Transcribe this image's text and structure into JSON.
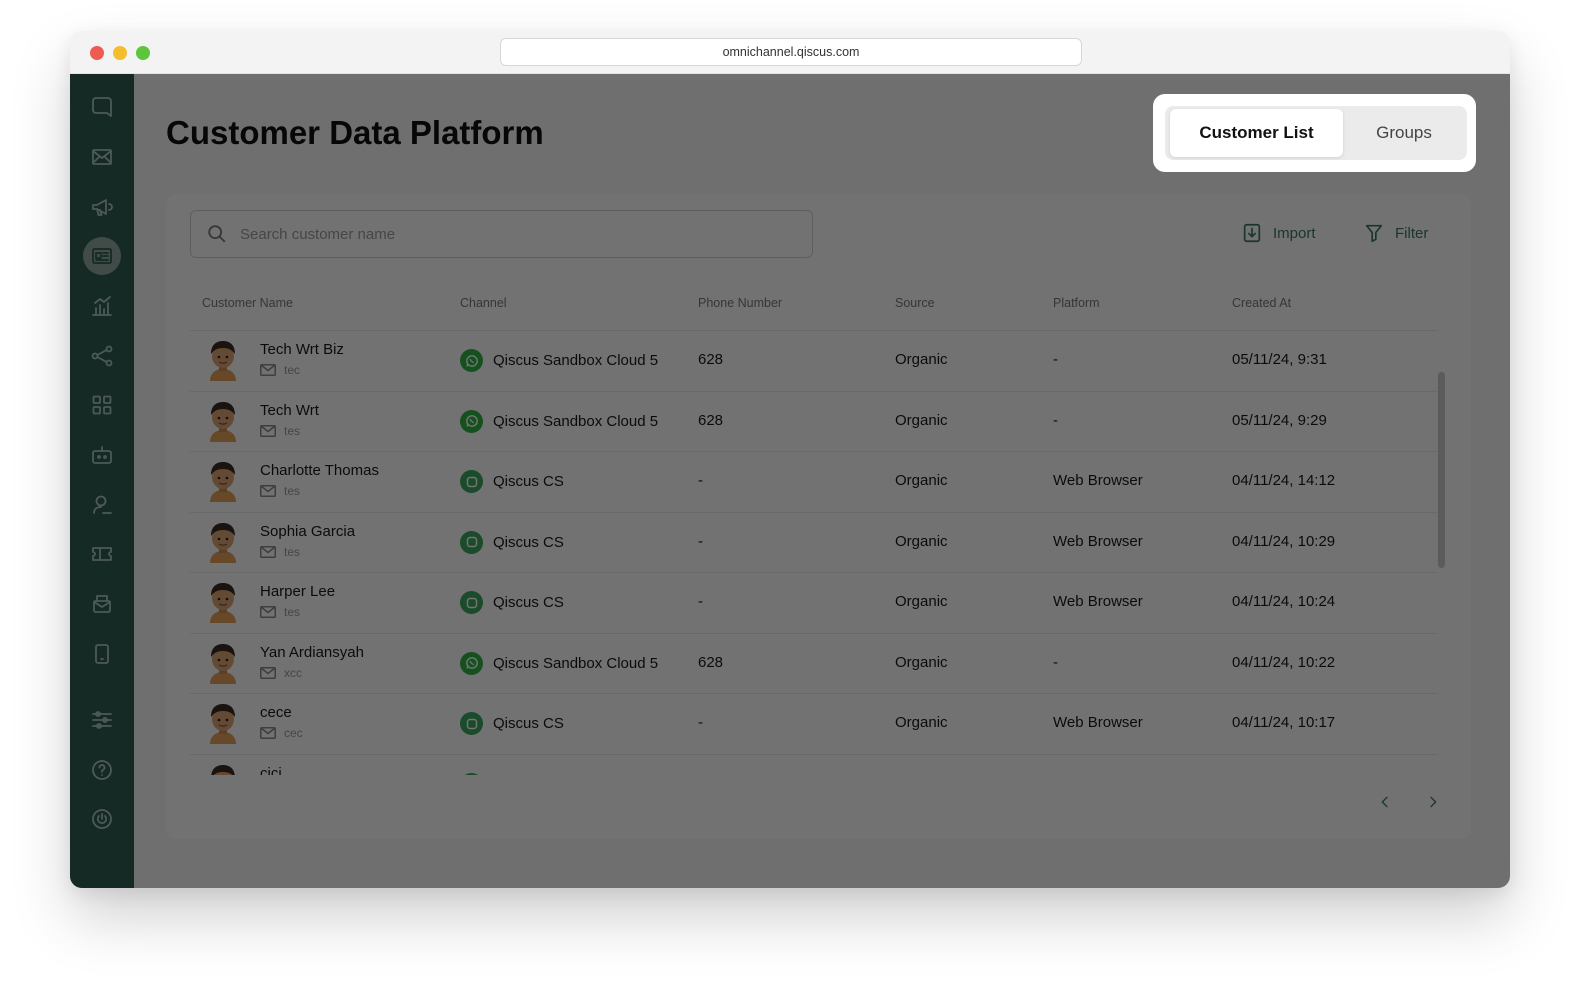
{
  "browser": {
    "url": "omnichannel.qiscus.com"
  },
  "sidebar": {
    "items": [
      {
        "icon": "qiscus-logo-icon",
        "active": false
      },
      {
        "icon": "inbox-icon",
        "active": false
      },
      {
        "icon": "megaphone-icon",
        "active": false
      },
      {
        "icon": "customer-data-icon",
        "active": true
      },
      {
        "icon": "analytics-icon",
        "active": false
      },
      {
        "icon": "integration-icon",
        "active": false
      },
      {
        "icon": "apps-icon",
        "active": false
      },
      {
        "icon": "bot-icon",
        "active": false
      },
      {
        "icon": "agent-icon",
        "active": false
      },
      {
        "icon": "ticket-icon",
        "active": false
      },
      {
        "icon": "mailbox-icon",
        "active": false
      },
      {
        "icon": "mobile-icon",
        "active": false
      },
      {
        "icon": "settings-sliders-icon",
        "active": false
      },
      {
        "icon": "help-icon",
        "active": false
      },
      {
        "icon": "power-icon",
        "active": false
      }
    ]
  },
  "header": {
    "title": "Customer Data Platform"
  },
  "tabs": {
    "customer_list": "Customer List",
    "groups": "Groups",
    "active": "Customer List"
  },
  "search": {
    "placeholder": "Search customer name",
    "value": ""
  },
  "toolbar": {
    "import_label": "Import",
    "filter_label": "Filter"
  },
  "table": {
    "columns": [
      "Customer Name",
      "Channel",
      "Phone Number",
      "Source",
      "Platform",
      "Created At"
    ],
    "rows": [
      {
        "name": "Tech Wrt Biz",
        "email": "tec",
        "channel": "Qiscus Sandbox Cloud 5",
        "channel_type": "whatsapp",
        "phone": "628",
        "source": "Organic",
        "platform": "-",
        "created": "05/11/24, 9:31"
      },
      {
        "name": "Tech Wrt",
        "email": "tes",
        "channel": "Qiscus Sandbox Cloud 5",
        "channel_type": "whatsapp",
        "phone": "628",
        "source": "Organic",
        "platform": "-",
        "created": "05/11/24, 9:29"
      },
      {
        "name": "Charlotte Thomas",
        "email": "tes",
        "channel": "Qiscus CS",
        "channel_type": "qiscus",
        "phone": "-",
        "source": "Organic",
        "platform": "Web Browser",
        "created": "04/11/24, 14:12"
      },
      {
        "name": "Sophia Garcia",
        "email": "tes",
        "channel": "Qiscus CS",
        "channel_type": "qiscus",
        "phone": "-",
        "source": "Organic",
        "platform": "Web Browser",
        "created": "04/11/24, 10:29"
      },
      {
        "name": "Harper Lee",
        "email": "tes",
        "channel": "Qiscus CS",
        "channel_type": "qiscus",
        "phone": "-",
        "source": "Organic",
        "platform": "Web Browser",
        "created": "04/11/24, 10:24"
      },
      {
        "name": "Yan Ardiansyah",
        "email": "xcc",
        "channel": "Qiscus Sandbox Cloud 5",
        "channel_type": "whatsapp",
        "phone": "628",
        "source": "Organic",
        "platform": "-",
        "created": "04/11/24, 10:22"
      },
      {
        "name": "cece",
        "email": "cec",
        "channel": "Qiscus CS",
        "channel_type": "qiscus",
        "phone": "-",
        "source": "Organic",
        "platform": "Web Browser",
        "created": "04/11/24, 10:17"
      },
      {
        "name": "cici",
        "email": "",
        "channel": "",
        "channel_type": "qiscus",
        "phone": "",
        "source": "",
        "platform": "",
        "created": ""
      }
    ]
  },
  "pagination": {
    "prev_icon": "chevron-left-icon",
    "next_icon": "chevron-right-icon"
  },
  "colors": {
    "sidebar": "#2f5e51",
    "accent": "#3b7667",
    "whatsapp": "#2fb344",
    "qiscus": "#3aa55d"
  }
}
